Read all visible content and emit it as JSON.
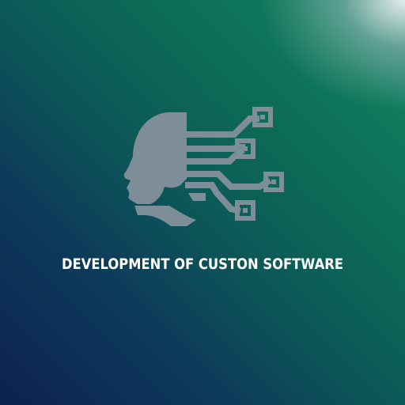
{
  "caption": "DEVELOPMENT OF CUSTON SOFTWARE",
  "colors": {
    "icon": "#7d8e98",
    "text": "#ffffff",
    "background_dark": "#0b2250",
    "background_green": "#0d6b55",
    "background_highlight": "#e8eeef"
  },
  "icons": [
    "ai-head-circuit-icon"
  ]
}
